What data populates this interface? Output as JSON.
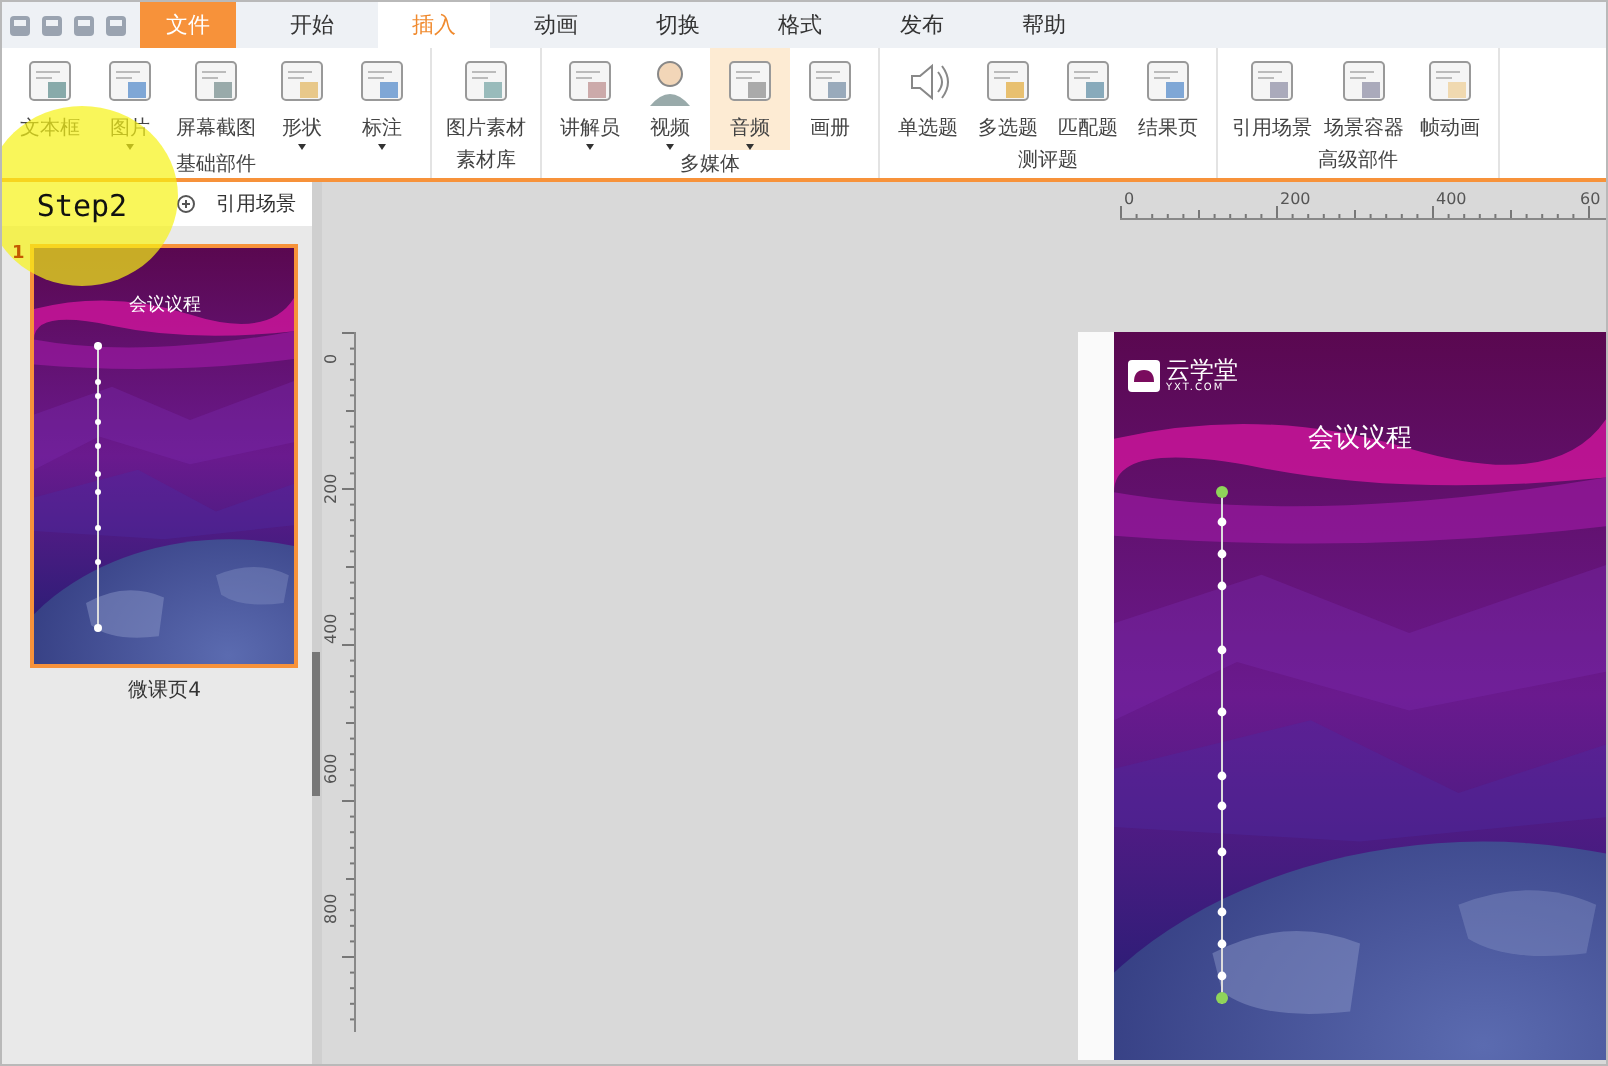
{
  "menu_tabs": [
    {
      "label": "文件",
      "kind": "file",
      "selected": false
    },
    {
      "label": "开始",
      "kind": "tab",
      "selected": false
    },
    {
      "label": "插入",
      "kind": "tab",
      "selected": true
    },
    {
      "label": "动画",
      "kind": "tab",
      "selected": false
    },
    {
      "label": "切换",
      "kind": "tab",
      "selected": false
    },
    {
      "label": "格式",
      "kind": "tab",
      "selected": false
    },
    {
      "label": "发布",
      "kind": "tab",
      "selected": false
    },
    {
      "label": "帮助",
      "kind": "tab",
      "selected": false
    }
  ],
  "ribbon_groups": [
    {
      "label": "基础部件",
      "items": [
        {
          "label": "文本框",
          "dropdown": false,
          "active": false
        },
        {
          "label": "图片",
          "dropdown": true,
          "active": false
        },
        {
          "label": "屏幕截图",
          "dropdown": false,
          "active": false
        },
        {
          "label": "形状",
          "dropdown": true,
          "active": false
        },
        {
          "label": "标注",
          "dropdown": true,
          "active": false
        }
      ]
    },
    {
      "label": "素材库",
      "items": [
        {
          "label": "图片素材",
          "dropdown": false,
          "active": false
        }
      ]
    },
    {
      "label": "多媒体",
      "items": [
        {
          "label": "讲解员",
          "dropdown": true,
          "active": false
        },
        {
          "label": "视频",
          "dropdown": true,
          "active": false
        },
        {
          "label": "音频",
          "dropdown": true,
          "active": true
        },
        {
          "label": "画册",
          "dropdown": false,
          "active": false
        }
      ]
    },
    {
      "label": "测评题",
      "items": [
        {
          "label": "单选题",
          "dropdown": false,
          "active": false
        },
        {
          "label": "多选题",
          "dropdown": false,
          "active": false
        },
        {
          "label": "匹配题",
          "dropdown": false,
          "active": false
        },
        {
          "label": "结果页",
          "dropdown": false,
          "active": false
        }
      ]
    },
    {
      "label": "高级部件",
      "items": [
        {
          "label": "引用场景",
          "dropdown": false,
          "active": false
        },
        {
          "label": "场景容器",
          "dropdown": false,
          "active": false
        },
        {
          "label": "帧动画",
          "dropdown": false,
          "active": false
        }
      ]
    }
  ],
  "panel_tabs": [
    {
      "label": "引用场景"
    }
  ],
  "slides": [
    {
      "number": "1",
      "caption": "微课页4",
      "title": "会议议程",
      "selected": true
    }
  ],
  "horizontal_ruler": {
    "labels": [
      "0",
      "200",
      "400",
      "60"
    ]
  },
  "vertical_ruler": {
    "labels": [
      "0",
      "200",
      "400",
      "600",
      "800"
    ]
  },
  "slide": {
    "logo_name": "云学堂",
    "logo_domain": "YXT.COM",
    "title": "会议议程"
  },
  "annotation": {
    "text": "Step2"
  }
}
